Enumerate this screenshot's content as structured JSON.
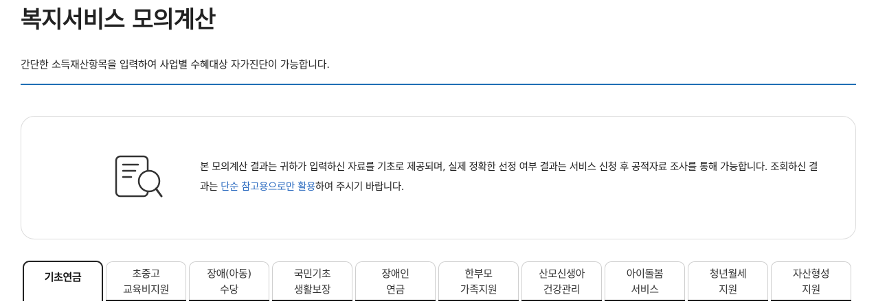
{
  "header": {
    "title": "복지서비스 모의계산",
    "subtitle": "간단한 소득재산항목을 입력하여 사업별 수혜대상 자가진단이 가능합니다."
  },
  "notice": {
    "icon": "document-search-icon",
    "text_before": "본 모의계산 결과는 귀하가 입력하신 자료를 기초로 제공되며, 실제 정확한 선정 여부 결과는 서비스 신청 후 공적자료 조사를 통해 가능합니다. 조회하신 결과는 ",
    "text_highlight": "단순 참고용으로만 활용",
    "text_after": "하여 주시기 바랍니다.",
    "highlight_color": "#2d6cc0"
  },
  "tabs": [
    {
      "line1": "기초연금",
      "line2": "",
      "active": true
    },
    {
      "line1": "초중고",
      "line2": "교육비지원",
      "active": false
    },
    {
      "line1": "장애(아동)",
      "line2": "수당",
      "active": false
    },
    {
      "line1": "국민기초",
      "line2": "생활보장",
      "active": false
    },
    {
      "line1": "장애인",
      "line2": "연금",
      "active": false
    },
    {
      "line1": "한부모",
      "line2": "가족지원",
      "active": false
    },
    {
      "line1": "산모신생아",
      "line2": "건강관리",
      "active": false
    },
    {
      "line1": "아이돌봄",
      "line2": "서비스",
      "active": false
    },
    {
      "line1": "청년월세",
      "line2": "지원",
      "active": false
    },
    {
      "line1": "자산형성",
      "line2": "지원",
      "active": false
    }
  ],
  "colors": {
    "accent_line": "#1f6fb5",
    "active_tab_border": "#222222"
  }
}
